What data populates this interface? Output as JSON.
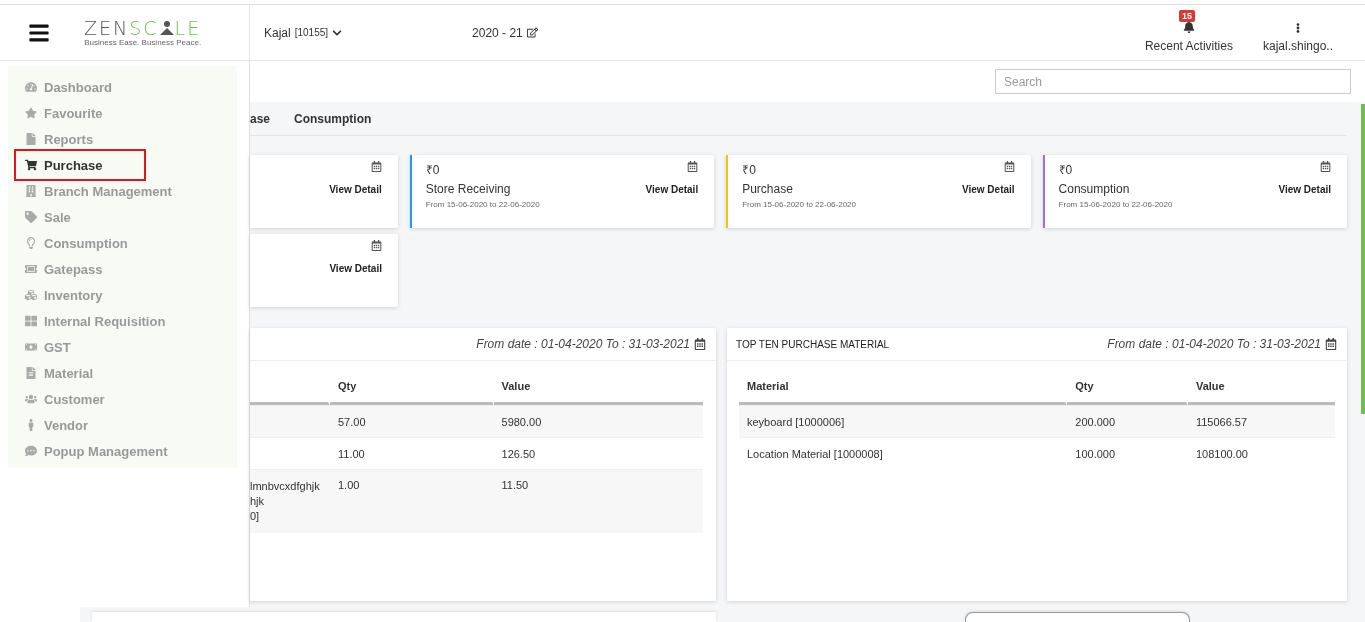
{
  "header": {
    "logo": {
      "lead": "ZEN",
      "accent": "SC",
      "tail": "LE",
      "tagline": "Business Ease. Business Peace."
    },
    "account": "Kajal",
    "account_code": "[10155]",
    "fiscal_year": "2020 - 21",
    "notifications": {
      "badge": "15",
      "label": "Recent Activities"
    },
    "user": "kajal.shingo.."
  },
  "sidebar": {
    "items": [
      {
        "label": "Dashboard",
        "selected": false
      },
      {
        "label": "Favourite",
        "selected": false
      },
      {
        "label": "Reports",
        "selected": false
      },
      {
        "label": "Purchase",
        "selected": true
      },
      {
        "label": "Branch Management",
        "selected": false
      },
      {
        "label": "Sale",
        "selected": false
      },
      {
        "label": "Consumption",
        "selected": false
      },
      {
        "label": "Gatepass",
        "selected": false
      },
      {
        "label": "Inventory",
        "selected": false
      },
      {
        "label": "Internal Requisition",
        "selected": false
      },
      {
        "label": "GST",
        "selected": false
      },
      {
        "label": "Material",
        "selected": false
      },
      {
        "label": "Customer",
        "selected": false
      },
      {
        "label": "Vendor",
        "selected": false
      },
      {
        "label": "Popup Management",
        "selected": false
      }
    ]
  },
  "search": {
    "placeholder": "Search"
  },
  "tabs": [
    {
      "label": "ase",
      "selected": false
    },
    {
      "label": "Consumption",
      "selected": false
    }
  ],
  "cards": [
    [
      {
        "kind": "cut",
        "action": "View Detail"
      },
      {
        "kind": "full",
        "amount": "₹0",
        "title": "Store Receiving",
        "period": "From 15-06-2020 to 22-06-2020",
        "action": "View Detail",
        "color": "#2196f3"
      },
      {
        "kind": "full",
        "amount": "₹0",
        "title": "Purchase",
        "period": "From 15-06-2020 to 22-06-2020",
        "action": "View Detail",
        "color": "#f4c20d"
      },
      {
        "kind": "full",
        "amount": "₹0",
        "title": "Consumption",
        "period": "From 15-06-2020 to 22-06-2020",
        "action": "View Detail",
        "color": "#a66bd8"
      }
    ],
    [
      {
        "kind": "cut",
        "action": "View Detail"
      }
    ]
  ],
  "panels": [
    {
      "range": "From date : 01-04-2020 To : 31-03-2021",
      "table": {
        "columns": [
          "Qty",
          "Value"
        ],
        "rows": [
          {
            "cut": [
              "57.00",
              "5980.00"
            ]
          },
          {
            "cut": [
              "11.00",
              "126.50"
            ]
          },
          {
            "cut_text": [
              "lmnbvcxdfghjk",
              "hjk",
              "0]"
            ],
            "cut": [
              "1.00",
              "11.50"
            ]
          }
        ]
      }
    },
    {
      "title": "TOP TEN PURCHASE MATERIAL",
      "range": "From date : 01-04-2020 To : 31-03-2021",
      "table": {
        "columns": [
          "Material",
          "Qty",
          "Value"
        ],
        "rows": [
          {
            "cut": [
              "keyboard [1000006]",
              "200.000",
              "115066.57"
            ]
          },
          {
            "cut": [
              "Location Material [1000008]",
              "100.000",
              "108100.00"
            ]
          }
        ]
      }
    }
  ]
}
